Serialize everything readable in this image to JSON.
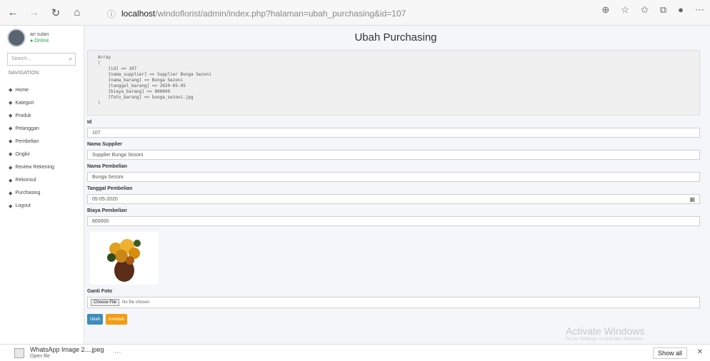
{
  "browser": {
    "host": "localhost",
    "path": "/windoflorist/admin/index.php?halaman=ubah_purchasing&id=107",
    "icons": [
      "back-icon",
      "forward-icon",
      "reload-icon",
      "home-icon",
      "info-icon",
      "zoom-icon",
      "star-icon",
      "favorites-icon",
      "collections-icon",
      "profile-icon",
      "more-icon"
    ]
  },
  "sidebar": {
    "user_name": "ari sulan",
    "user_status": "● Online",
    "search_placeholder": "Search...",
    "nav_header": "NAVIGATION",
    "items": [
      {
        "label": "Home",
        "icon": "home-icon"
      },
      {
        "label": "Kategori",
        "icon": "tag-icon"
      },
      {
        "label": "Produk",
        "icon": "product-icon"
      },
      {
        "label": "Pelanggan",
        "icon": "user-icon"
      },
      {
        "label": "Pembelian",
        "icon": "cart-icon"
      },
      {
        "label": "Ongkir",
        "icon": "truck-icon"
      },
      {
        "label": "Review Rekening",
        "icon": "wallet-icon"
      },
      {
        "label": "Rekonsul",
        "icon": "chat-icon"
      },
      {
        "label": "Purchasing",
        "icon": "box-icon"
      },
      {
        "label": "Logout",
        "icon": "logout-icon"
      }
    ]
  },
  "main": {
    "title": "Ubah Purchasing",
    "debug_text": "Array\n(\n    [id] => 107\n    [nama_supplier] => Supplier Bunga Sezoni\n    [nama_barang] => Bunga Sezoni\n    [tanggal_barang] => 2020-05-05\n    [biaya_barang] => 800000\n    [foto_barang] => bunga_sezoni.jpg\n)",
    "fields": [
      {
        "label": "Id",
        "value": "107"
      },
      {
        "label": "Nama Supplier",
        "value": "Supplier Bunga Sezoni"
      },
      {
        "label": "Nama Pembelian",
        "value": "Bunga Sezoni"
      },
      {
        "label": "Tanggal Pembelian",
        "value": "05-05-2020"
      },
      {
        "label": "Biaya Pembelian",
        "value": "800000"
      }
    ],
    "foto_label": "Ganti Foto",
    "file_button": "Choose File",
    "file_text": "No file chosen",
    "save_label": "Ubah",
    "cancel_label": "Kembali"
  },
  "watermark": {
    "title": "Activate Windows",
    "subtitle": "Go to Settings to activate Windows."
  },
  "downloads": {
    "file_name": "WhatsApp Image 2....jpeg",
    "file_sub": "Open file",
    "more": "⋯",
    "show_all": "Show all",
    "close": "✕"
  },
  "colors": {
    "primary": "#3c8dbc",
    "warning": "#f39c12"
  }
}
